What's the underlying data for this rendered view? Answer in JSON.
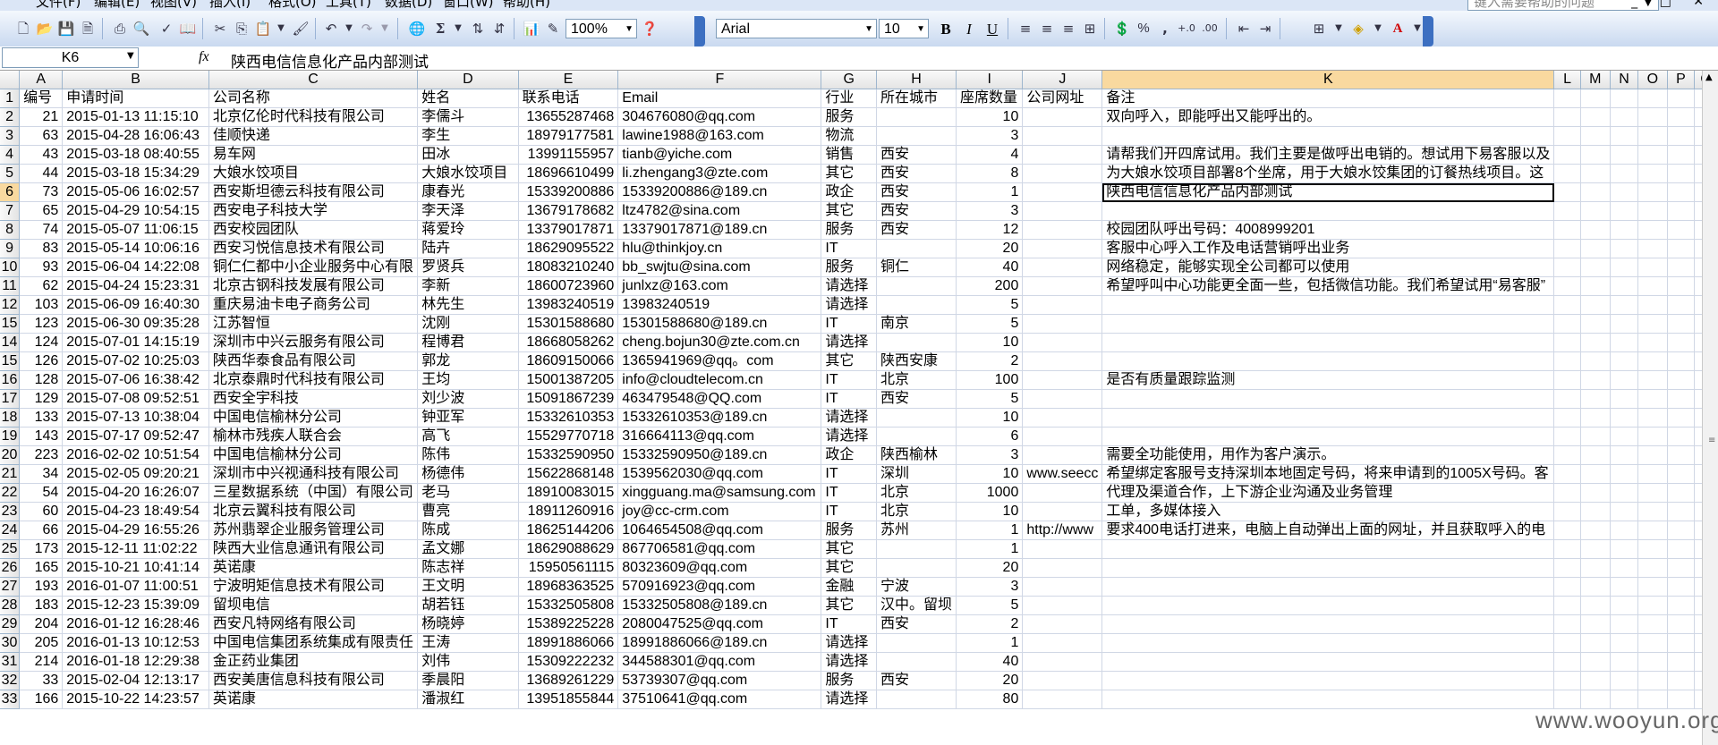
{
  "menu": [
    "文件(F)",
    "编辑(E)",
    "视图(V)",
    "插入(I)",
    "格式(O)",
    "工具(T)",
    "数据(D)",
    "窗口(W)",
    "帮助(H)"
  ],
  "help_placeholder": "键入需要帮助的问题",
  "toolbar": {
    "zoom": "100%",
    "font_name": "Arial",
    "font_size": "10",
    "bold": "B",
    "italic": "I",
    "underline": "U",
    "percent": "%",
    "comma": ","
  },
  "formula_bar": {
    "cell_ref": "K6",
    "fx": "fx",
    "content": "陕西电信信息化产品内部测试"
  },
  "columns": [
    "A",
    "B",
    "C",
    "D",
    "E",
    "F",
    "G",
    "H",
    "I",
    "J",
    "K",
    "L",
    "M",
    "N",
    "O",
    "P",
    "Q"
  ],
  "active_column": "K",
  "active_row": 6,
  "rows": [
    {
      "n": 1,
      "c": [
        "编号",
        "申请时间",
        "公司名称",
        "姓名",
        "联系电话",
        "Email",
        "行业",
        "所在城市",
        "座席数量",
        "公司网址",
        "备注"
      ]
    },
    {
      "n": 2,
      "c": [
        "21",
        "2015-01-13 11:15:10",
        "北京亿伦时代科技有限公司",
        "李儒斗",
        "13655287468",
        "304676080@qq.com",
        "服务",
        "",
        "10",
        "",
        "双向呼入，即能呼出又能呼出的。"
      ]
    },
    {
      "n": 3,
      "c": [
        "63",
        "2015-04-28 16:06:43",
        "佳顺快递",
        "李生",
        "18979177581",
        "lawine1988@163.com",
        "物流",
        "",
        "3",
        "",
        ""
      ]
    },
    {
      "n": 4,
      "c": [
        "43",
        "2015-03-18 08:40:55",
        "易车网",
        "田冰",
        "13991155957",
        "tianb@yiche.com",
        "销售",
        "西安",
        "4",
        "",
        "请帮我们开四席试用。我们主要是做呼出电销的。想试用下易客服以及"
      ]
    },
    {
      "n": 5,
      "c": [
        "44",
        "2015-03-18 15:34:29",
        "大娘水饺项目",
        "大娘水饺项目",
        "18696610499",
        "li.zhengang3@zte.com",
        "其它",
        "西安",
        "8",
        "",
        "为大娘水饺项目部署8个坐席，用于大娘水饺集团的订餐热线项目。这"
      ]
    },
    {
      "n": 6,
      "c": [
        "73",
        "2015-05-06 16:02:57",
        "西安斯坦德云科技有限公司",
        "康春光",
        "15339200886",
        "15339200886@189.cn",
        "政企",
        "西安",
        "1",
        "",
        "陕西电信信息化产品内部测试"
      ]
    },
    {
      "n": 7,
      "c": [
        "65",
        "2015-04-29 10:54:15",
        "西安电子科技大学",
        "李天泽",
        "13679178682",
        "ltz4782@sina.com",
        "其它",
        "西安",
        "3",
        "",
        ""
      ]
    },
    {
      "n": 8,
      "c": [
        "74",
        "2015-05-07 11:06:15",
        "西安校园团队",
        "蒋爱玲",
        "13379017871",
        "13379017871@189.cn",
        "服务",
        "西安",
        "12",
        "",
        "校园团队呼出号码：4008999201"
      ]
    },
    {
      "n": 9,
      "c": [
        "83",
        "2015-05-14 10:06:16",
        "西安习悦信息技术有限公司",
        "陆卉",
        "18629095522",
        "hlu@thinkjoy.cn",
        "IT",
        "",
        "20",
        "",
        "客服中心呼入工作及电话营销呼出业务"
      ]
    },
    {
      "n": 10,
      "c": [
        "93",
        "2015-06-04 14:22:08",
        "铜仁仁都中小企业服务中心有限",
        "罗贤兵",
        "18083210240",
        "bb_swjtu@sina.com",
        "服务",
        "铜仁",
        "40",
        "",
        "网络稳定，能够实现全公司都可以使用"
      ]
    },
    {
      "n": 11,
      "c": [
        "62",
        "2015-04-24 15:23:31",
        "北京古钢科技发展有限公司",
        "李新",
        "18600723960",
        "junlxz@163.com",
        "请选择",
        "",
        "200",
        "",
        "希望呼叫中心功能更全面一些，包括微信功能。我们希望试用“易客服”"
      ]
    },
    {
      "n": 12,
      "c": [
        "103",
        "2015-06-09 16:40:30",
        "重庆易油卡电子商务公司",
        "林先生",
        "13983240519",
        "13983240519",
        "请选择",
        "",
        "5",
        "",
        ""
      ]
    },
    {
      "n": 15,
      "c": [
        "123",
        "2015-06-30 09:35:28",
        "江苏智恒",
        "沈刚",
        "15301588680",
        "15301588680@189.cn",
        "IT",
        "南京",
        "5",
        "",
        ""
      ]
    },
    {
      "n": 14,
      "c": [
        "124",
        "2015-07-01 14:15:19",
        "深圳市中兴云服务有限公司",
        "程博君",
        "18668058262",
        "cheng.bojun30@zte.com.cn",
        "请选择",
        "",
        "10",
        "",
        ""
      ]
    },
    {
      "n": 15,
      "c": [
        "126",
        "2015-07-02 10:25:03",
        "陕西华泰食品有限公司",
        "郭龙",
        "18609150066",
        "1365941969@qq。com",
        "其它",
        "陕西安康",
        "2",
        "",
        ""
      ]
    },
    {
      "n": 16,
      "c": [
        "128",
        "2015-07-06 16:38:42",
        "北京泰鼎时代科技有限公司",
        "王均",
        "15001387205",
        "info@cloudtelecom.cn",
        "IT",
        "北京",
        "100",
        "",
        "是否有质量跟踪监测"
      ]
    },
    {
      "n": 17,
      "c": [
        "129",
        "2015-07-08 09:52:51",
        "西安全宇科技",
        "刘少波",
        "15091867239",
        "463479548@QQ.com",
        "IT",
        "西安",
        "5",
        "",
        ""
      ]
    },
    {
      "n": 18,
      "c": [
        "133",
        "2015-07-13 10:38:04",
        "中国电信榆林分公司",
        "钟亚军",
        "15332610353",
        "15332610353@189.cn",
        "请选择",
        "",
        "10",
        "",
        ""
      ]
    },
    {
      "n": 19,
      "c": [
        "143",
        "2015-07-17 09:52:47",
        "榆林市残疾人联合会",
        "高飞",
        "15529770718",
        "316664113@qq.com",
        "请选择",
        "",
        "6",
        "",
        ""
      ]
    },
    {
      "n": 20,
      "c": [
        "223",
        "2016-02-02 10:51:54",
        "中国电信榆林分公司",
        "陈伟",
        "15332590950",
        "15332590950@189.cn",
        "政企",
        "陕西榆林",
        "3",
        "",
        "需要全功能使用，用作为客户演示。"
      ]
    },
    {
      "n": 21,
      "c": [
        "34",
        "2015-02-05 09:20:21",
        "深圳市中兴视通科技有限公司",
        "杨德伟",
        "15622868148",
        "1539562030@qq.com",
        "IT",
        "深圳",
        "10",
        "www.seecc",
        "希望绑定客服号支持深圳本地固定号码，将来申请到的1005X号码。客"
      ]
    },
    {
      "n": 22,
      "c": [
        "54",
        "2015-04-20 16:26:07",
        "三星数据系统（中国）有限公司",
        "老马",
        "18910083015",
        "xingguang.ma@samsung.com",
        "IT",
        "北京",
        "1000",
        "",
        "代理及渠道合作，上下游企业沟通及业务管理"
      ]
    },
    {
      "n": 23,
      "c": [
        "60",
        "2015-04-23 18:49:54",
        "北京云翼科技有限公司",
        "曹亮",
        "18911260916",
        "joy@cc-crm.com",
        "IT",
        "北京",
        "10",
        "",
        "工单，多媒体接入"
      ]
    },
    {
      "n": 24,
      "c": [
        "66",
        "2015-04-29 16:55:26",
        "苏州翡翠企业服务管理公司",
        "陈成",
        "18625144206",
        "1064654508@qq.com",
        "服务",
        "苏州",
        "1",
        "http://www",
        "要求400电话打进来，电脑上自动弹出上面的网址，并且获取呼入的电"
      ]
    },
    {
      "n": 25,
      "c": [
        "173",
        "2015-12-11 11:02:22",
        "陕西大业信息通讯有限公司",
        "孟文娜",
        "18629088629",
        "867706581@qq.com",
        "其它",
        "",
        "1",
        "",
        ""
      ]
    },
    {
      "n": 26,
      "c": [
        "165",
        "2015-10-21 10:41:14",
        "英诺康",
        "陈志祥",
        "15950561115",
        "80323609@qq.com",
        "其它",
        "",
        "20",
        "",
        ""
      ]
    },
    {
      "n": 27,
      "c": [
        "193",
        "2016-01-07 11:00:51",
        "宁波明矩信息技术有限公司",
        "王文明",
        "18968363525",
        "570916923@qq.com",
        "金融",
        "宁波",
        "3",
        "",
        ""
      ]
    },
    {
      "n": 28,
      "c": [
        "183",
        "2015-12-23 15:39:09",
        "留坝电信",
        "胡若钰",
        "15332505808",
        "15332505808@189.cn",
        "其它",
        "汉中。留坝",
        "5",
        "",
        ""
      ]
    },
    {
      "n": 29,
      "c": [
        "204",
        "2016-01-12 16:28:46",
        "西安凡特网络有限公司",
        "杨晓婷",
        "15389225228",
        "2080047525@qq.com",
        "IT",
        "西安",
        "2",
        "",
        ""
      ]
    },
    {
      "n": 30,
      "c": [
        "205",
        "2016-01-13 10:12:53",
        "中国电信集团系统集成有限责任",
        "王涛",
        "18991886066",
        "18991886066@189.cn",
        "请选择",
        "",
        "1",
        "",
        ""
      ]
    },
    {
      "n": 31,
      "c": [
        "214",
        "2016-01-18 12:29:38",
        "金正药业集团",
        "刘伟",
        "15309222232",
        "344588301@qq.com",
        "请选择",
        "",
        "40",
        "",
        ""
      ]
    },
    {
      "n": 32,
      "c": [
        "33",
        "2015-02-04 12:13:17",
        "西安美唐信息科技有限公司",
        "季晨阳",
        "13689261229",
        "53739307@qq.com",
        "服务",
        "西安",
        "20",
        "",
        ""
      ]
    },
    {
      "n": 33,
      "c": [
        "166",
        "2015-10-22 14:23:57",
        "英诺康",
        "潘淑红",
        "13951855844",
        "37510641@qq.com",
        "请选择",
        "",
        "80",
        "",
        ""
      ]
    }
  ],
  "watermark": "www.wooyun.org"
}
